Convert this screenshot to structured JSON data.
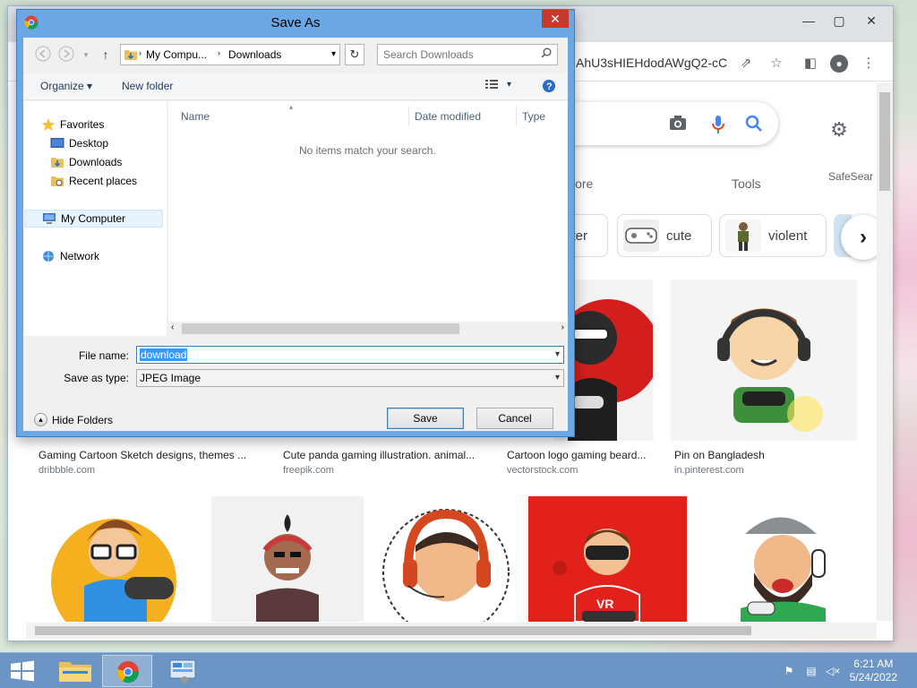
{
  "browser": {
    "url_fragment": "AhU3sHIEHdodAWgQ2-cC",
    "search_tabs": {
      "more": "lore",
      "tools": "Tools",
      "safesearch": "SafeSear"
    },
    "chips": [
      {
        "label": "ster"
      },
      {
        "label": "cute"
      },
      {
        "label": "violent"
      }
    ],
    "results_row1": [
      {
        "caption": "Gaming Cartoon Sketch designs, themes ...",
        "source": "dribbble.com"
      },
      {
        "caption": "Cute panda gaming illustration. animal...",
        "source": "freepik.com"
      },
      {
        "caption": "Cartoon logo gaming beard...",
        "source": "vectorstock.com"
      },
      {
        "caption": "Pin on Bangladesh",
        "source": "in.pinterest.com"
      }
    ]
  },
  "dialog": {
    "title": "Save As",
    "close": "✕",
    "address": {
      "part1": "My Compu...",
      "part2": "Downloads"
    },
    "search_placeholder": "Search Downloads",
    "commands": {
      "organize": "Organize",
      "new_folder": "New folder"
    },
    "nav": {
      "favorites": "Favorites",
      "desktop": "Desktop",
      "downloads": "Downloads",
      "recent": "Recent places",
      "computer": "My Computer",
      "network": "Network"
    },
    "columns": {
      "name": "Name",
      "date_modified": "Date modified",
      "type": "Type"
    },
    "empty_message": "No items match your search.",
    "file_name_label": "File name:",
    "file_name_value": "download",
    "save_type_label": "Save as type:",
    "save_type_value": "JPEG Image",
    "hide_folders": "Hide Folders",
    "save": "Save",
    "cancel": "Cancel"
  },
  "taskbar": {
    "time": "6:21 AM",
    "date": "5/24/2022"
  },
  "colors": {
    "dialog_frame": "#6aa7e4",
    "taskbar": "#6a95c4",
    "close_red": "#c7392c",
    "selection": "#3399ff"
  },
  "icons": [
    "chrome-icon",
    "back-arrow-icon",
    "forward-arrow-icon",
    "up-arrow-icon",
    "refresh-icon",
    "search-icon",
    "view-icon",
    "help-icon",
    "star-icon",
    "desktop-icon",
    "folder-icon",
    "computer-icon",
    "network-icon",
    "camera-icon",
    "mic-icon",
    "gear-icon",
    "windows-start-icon",
    "file-explorer-icon"
  ]
}
